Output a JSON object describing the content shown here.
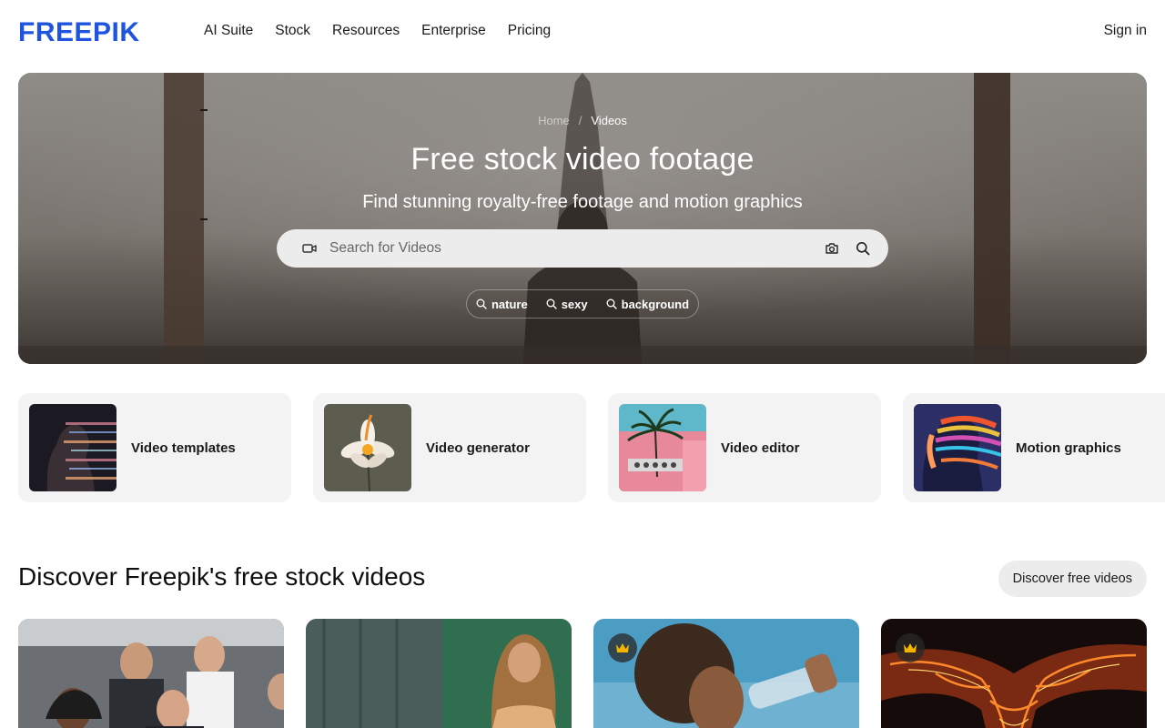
{
  "header": {
    "logo_text": "FREEPIK",
    "nav": [
      "AI Suite",
      "Stock",
      "Resources",
      "Enterprise",
      "Pricing"
    ],
    "sign_in": "Sign in"
  },
  "hero": {
    "breadcrumb": {
      "home": "Home",
      "separator": "/",
      "current": "Videos"
    },
    "title": "Free stock video footage",
    "subtitle": "Find stunning royalty-free footage and motion graphics",
    "search": {
      "placeholder": "Search for Videos"
    },
    "suggestions": [
      "nature",
      "sexy",
      "background"
    ]
  },
  "categories": [
    {
      "label": "Video templates"
    },
    {
      "label": "Video generator"
    },
    {
      "label": "Video editor"
    },
    {
      "label": "Motion graphics"
    }
  ],
  "section": {
    "title": "Discover Freepik's free stock videos",
    "button": "Discover free videos"
  },
  "videos": [
    {
      "premium": false
    },
    {
      "premium": false
    },
    {
      "premium": true
    },
    {
      "premium": true
    }
  ],
  "colors": {
    "brand": "#1f54e0",
    "crown": "#f5b400"
  }
}
